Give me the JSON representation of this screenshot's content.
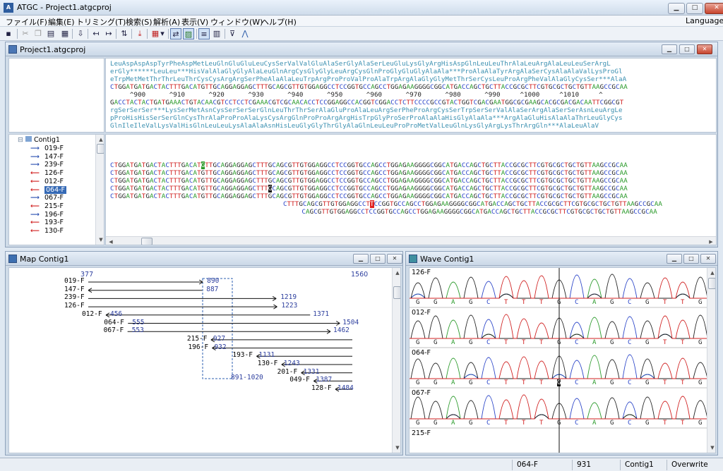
{
  "app": {
    "title": "ATGC - Project1.atgcproj",
    "icon_text": "A"
  },
  "menubar": {
    "items": [
      "ファイル(F)",
      "編集(E)",
      "トリミング(T)",
      "検索(S)",
      "解析(A)",
      "表示(V)",
      "ウィンドウ(W)",
      "ヘルプ(H)"
    ],
    "language": "Language"
  },
  "project_window": {
    "title": "Project1.atgcproj",
    "translation_lines": [
      "LeuAspAspAspTyrPheAspMetLeuGlnGluGluLeuCysSerValValGluAlaSerGlyAlaSerLeuGluLysGlyArgHisAspGlnLeuLeuThrAlaLeuArgAlaLeuLeuSerArgL",
      "erGly******LeuLeu***HisValAlaGlyGlyAlaLeuGlnArgCysGlyGlyLeuArgCysGlnProGlyGluGlyAlaAla***ProAlaAlaTyrArgAlaSerCysAlaAlaValLysProGl",
      "eTrpMetMetThrThrLeuThrCysCysArgArgSerPheAlaAlaLeuTrpArgProProValProAlaTrpArgAlaGlyGlyMetThrSerCysLeuProArgPheValAlaGlyCysSer***AlaA"
    ],
    "consensus": "CTGGATGATGACTACTTTGACATGTTGCAGGAGGAGCTTTGCAGCGTTGTGGAGGCCTCCGGTGCCAGCCTGGAGAAGGGGCGGCATGACCAGCTGCTTACCGCGCTTCGTGCGCTGCTGTTAAGCCGCAA",
    "ruler": "     ^900      ^910      ^920      ^930      ^940      ^950      ^960      ^970      ^980      ^990     ^1000     ^1010     ^",
    "complement": "GACCTACTACTGATGAAACTGTACAACGTCCTCCTCGAAACGTCGCAACACCTCCGGAGGCCACGGTCGGACCTCTTCCCCGCCGTACTGGTCGACGAATGGCGCGAAGCACGCGACGACAATTCGGCGT",
    "reverse_translation_lines": [
      "rgSerSerSer***LysSerMetAsnCysSerSerSerGlnLeuThrThrSerAlaGluProAlaLeuArgSerPheProArgCysSerTrpSerSerValAlaSerArgAlaSerSerAsnLeuArgLe",
      "pProHisHisSerSerGlnCysThrAlaProProAlaLysCysArgGlnProProArgArgHisTrpGlyProSerProAlaAlaHisGlyAlaAla***ArgAlaGluHisAlaAlaThrLeuGlyCys",
      "GlnIleIleValLysValHisGlnLeuLeuLysAlaAlaAsnHisLeuGlyGlyThrGlyAlaGlnLeuLeuProProMetValLeuGlnLysGlyArgLysThrArgGln***AlaLeuAlaV"
    ],
    "tree": {
      "root": "Contig1",
      "items": [
        {
          "name": "019-F",
          "dir": "fwd"
        },
        {
          "name": "147-F",
          "dir": "fwd"
        },
        {
          "name": "239-F",
          "dir": "fwd"
        },
        {
          "name": "126-F",
          "dir": "rev"
        },
        {
          "name": "012-F",
          "dir": "rev"
        },
        {
          "name": "064-F",
          "dir": "rev",
          "selected": true
        },
        {
          "name": "067-F",
          "dir": "fwd"
        },
        {
          "name": "215-F",
          "dir": "rev"
        },
        {
          "name": "196-F",
          "dir": "fwd"
        },
        {
          "name": "193-F",
          "dir": "rev"
        },
        {
          "name": "130-F",
          "dir": "rev"
        }
      ]
    },
    "reads": [
      {
        "indent": 0,
        "pre": "CTGGATGATGACTACTTTGACAT",
        "hl": "G",
        "hlcls": "hl-g",
        "post": "TTGCAGGAGGAGCTTTGCAGCGTTGTGGAGGCCTCCGGTGCCAGCCTGGAGAAGGGGCGGCATGACCAGCTGCTTACCGCGCTTCGTGCGCTGCTGTTAAGCCGCAA"
      },
      {
        "indent": 0,
        "pre": "CTGGATGATGACTACTTTGACATGTTGCAGGAGGAGCTTTGCAGCGTTGTGGAGGCCTCCGGTGCCAGCCTGGAGAAGGGGCGGCATGACCAGCTGCTTACCGCGCTTCGTGCGCTGCTGTTAAGCCGCAA",
        "hl": "",
        "hlcls": "",
        "post": ""
      },
      {
        "indent": 0,
        "pre": "CTGGATGATGACTACTTTGACATGTTGCAGGAGGAGCTTTGCAGCGTTGTGGAGGCCTCCGGTGCCAGCCTGGAGAAGGGGCGGCATGACCAGCTGCTTACCGCGCTTCGTGCGCTGCTGTTAAGCCGCAA",
        "hl": "",
        "hlcls": "",
        "post": ""
      },
      {
        "indent": 0,
        "pre": "CTGGATGATGACTACTTTGACATGTTGCAGGAGGAGCTTT",
        "hl": "G",
        "hlcls": "hl-k",
        "post": "CAGCGTTGTGGAGGCCTCCGGTGCCAGCCTGGAGAAGGGGCGGCATGACCAGCTGCTTACCGCGCTTCGTGCGCTGCTGTTAAGCCGCAA"
      },
      {
        "indent": 0,
        "pre": "CTGGATGATGACTACTTTGACATGTTGCAGGAGGAGCTTTGCAGCGTTGTGGAGGCCTCCGGTGCCAGCCTGGAGAAGGGGCGGCATGACCAGCTGCTTACCGCGCTTCGTGCGCTGCTGTTAAGCCGCAA",
        "hl": "",
        "hlcls": "",
        "post": ""
      },
      {
        "indent": 37,
        "pre": "CTTTGCAGCGTTGTGGAGGCCT",
        "hl": "T",
        "hlcls": "hl-r",
        "post": "CCGGTGCCAGCCTGGAGAAGGGGCGGCATGACCAGCTGCTTACCGCGCTTCGTGCGCTGCTGTTAAGCCGCAA"
      },
      {
        "indent": 41,
        "pre": "CAGCGTTGTGGAGGCCTCCGGTGCCAGCCTGGAGAAGGGGCGGCATGACCAGCTGCTTACCGCGCTTCGTGCGCTGCTGTTAAGCCGCAA",
        "hl": "",
        "hlcls": "",
        "post": ""
      }
    ]
  },
  "map_window": {
    "title": "Map Contig1",
    "start_label": "377",
    "end_label": "1560",
    "range_label": "891-1020",
    "rows": [
      {
        "name": "019-F",
        "start": 377,
        "end": 890,
        "label": "890",
        "dir": "fwd"
      },
      {
        "name": "147-F",
        "start": 377,
        "end": 887,
        "label": "887",
        "dir": "rev"
      },
      {
        "name": "239-F",
        "start": 377,
        "end": 1219,
        "label": "1219",
        "dir": "fwd"
      },
      {
        "name": "126-F",
        "start": 377,
        "end": 1223,
        "label": "1223",
        "dir": "fwd"
      },
      {
        "name": "012-F",
        "start": 456,
        "end": 1371,
        "label": "456",
        "end_label": "1371",
        "dir": "rev"
      },
      {
        "name": "064-F",
        "start": 555,
        "end": 1504,
        "label": "555",
        "end_label": "1504",
        "dir": "fwd"
      },
      {
        "name": "067-F",
        "start": 553,
        "end": 1462,
        "label": "553",
        "end_label": "1462",
        "dir": "fwd"
      },
      {
        "name": "215-F",
        "start": 927,
        "end": 1560,
        "label": "927",
        "dir": "rev"
      },
      {
        "name": "196-F",
        "start": 932,
        "end": 1560,
        "label": "932",
        "dir": "rev"
      },
      {
        "name": "193-F",
        "start": 1131,
        "end": 1560,
        "label": "1131",
        "dir": "rev"
      },
      {
        "name": "130-F",
        "start": 1243,
        "end": 1560,
        "label": "1243",
        "dir": "rev"
      },
      {
        "name": "201-F",
        "start": 1331,
        "end": 1560,
        "label": "1331",
        "dir": "rev"
      },
      {
        "name": "049-F",
        "start": 1387,
        "end": 1560,
        "label": "1387",
        "dir": "rev"
      },
      {
        "name": "128-F",
        "start": 1484,
        "end": 1560,
        "label": "1484",
        "dir": "rev"
      }
    ]
  },
  "wave_window": {
    "title": "Wave Contig1",
    "traces": [
      {
        "name": "126-F",
        "bases": [
          "G",
          "G",
          "A",
          "G",
          "C",
          "T",
          "T",
          "T",
          "G",
          "C",
          "A",
          "G",
          "C",
          "G",
          "T",
          "T",
          "G"
        ]
      },
      {
        "name": "012-F",
        "bases": [
          "G",
          "G",
          "A",
          "G",
          "C",
          "T",
          "T",
          "T",
          "G",
          "C",
          "A",
          "G",
          "C",
          "G",
          "T",
          "T",
          "G"
        ]
      },
      {
        "name": "064-F",
        "bases": [
          "G",
          "G",
          "A",
          "G",
          "C",
          "T",
          "T",
          "T",
          "G",
          "C",
          "A",
          "G",
          "C",
          "G",
          "T",
          "T",
          "G"
        ],
        "highlight": 8
      },
      {
        "name": "067-F",
        "bases": [
          "G",
          "G",
          "A",
          "G",
          "C",
          "T",
          "T",
          "T",
          "G",
          "C",
          "A",
          "G",
          "C",
          "G",
          "T",
          "T",
          "G"
        ]
      },
      {
        "name": "215-F",
        "bases": []
      }
    ]
  },
  "status": {
    "read": "064-F",
    "pos": "931",
    "contig": "Contig1",
    "mode": "Overwrite"
  },
  "colors": {
    "A": "#2a9a2a",
    "C": "#2a44c8",
    "G": "#222222",
    "T": "#d02020",
    "amino": "#3a8fb0",
    "map_number": "#2d3f9e"
  }
}
